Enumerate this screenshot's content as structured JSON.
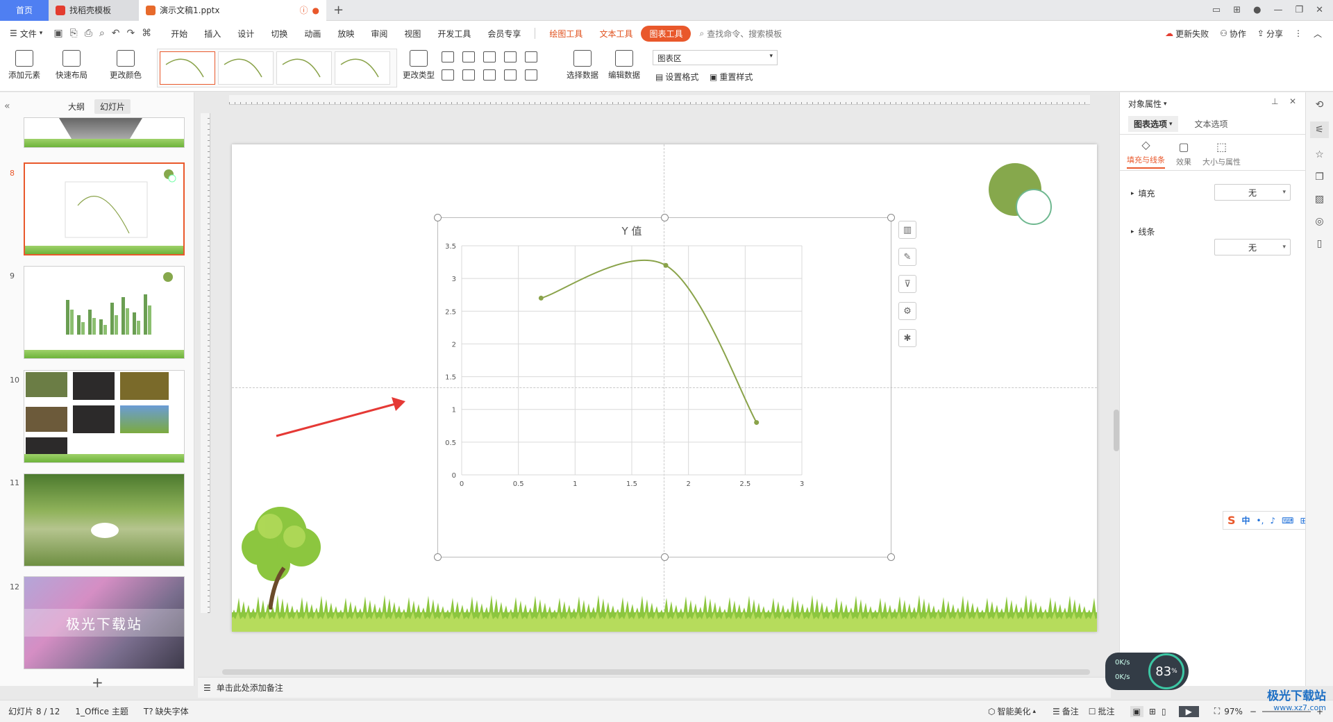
{
  "titlebar": {
    "tabs": [
      {
        "label": "首页"
      },
      {
        "label": "找稻壳模板"
      },
      {
        "label": "演示文稿1.pptx"
      }
    ],
    "new_tab": "+"
  },
  "menubar": {
    "file": "文件",
    "items": [
      "开始",
      "插入",
      "设计",
      "切换",
      "动画",
      "放映",
      "审阅",
      "视图",
      "开发工具",
      "会员专享"
    ],
    "tool_tabs": [
      "绘图工具",
      "文本工具",
      "图表工具"
    ],
    "search_placeholder": "查找命令、搜索模板",
    "right": {
      "update": "更新失败",
      "collab": "协作",
      "share": "分享"
    }
  },
  "ribbon": {
    "add_element": "添加元素",
    "quick_layout": "快速布局",
    "change_color": "更改颜色",
    "change_type": "更改类型",
    "select_data": "选择数据",
    "edit_data": "编辑数据",
    "chart_area_select": "图表区",
    "set_format": "设置格式",
    "reset_style": "重置样式"
  },
  "leftpanel": {
    "tab_outline": "大纲",
    "tab_slides": "幻灯片",
    "numbers": [
      "8",
      "9",
      "10",
      "11",
      "12"
    ],
    "slide12_text": "极光下载站",
    "add": "+"
  },
  "chart_data": {
    "type": "scatter",
    "title": "Y 值",
    "xlim": [
      0,
      3
    ],
    "ylim": [
      0,
      3.5
    ],
    "xticks": [
      "0",
      "0.5",
      "1",
      "1.5",
      "2",
      "2.5",
      "3"
    ],
    "yticks": [
      "0",
      "0.5",
      "1",
      "1.5",
      "2",
      "2.5",
      "3",
      "3.5"
    ],
    "points": [
      {
        "x": 0.7,
        "y": 2.7
      },
      {
        "x": 1.8,
        "y": 3.2
      },
      {
        "x": 2.6,
        "y": 0.8
      }
    ],
    "smooth": true,
    "grid": true,
    "color": "#8aa34a"
  },
  "rightpanel": {
    "title": "对象属性",
    "tab_chart": "图表选项",
    "tab_text": "文本选项",
    "sub_fill": "填充与线条",
    "sub_effect": "效果",
    "sub_size": "大小与属性",
    "fill_label": "填充",
    "fill_value": "无",
    "line_label": "线条",
    "line_value": "无"
  },
  "notes": {
    "placeholder": "单击此处添加备注"
  },
  "statusbar": {
    "slide_info": "幻灯片 8 / 12",
    "theme": "1_Office 主题",
    "missing_font": "缺失字体",
    "beautify": "智能美化",
    "notes_btn": "备注",
    "comment_btn": "批注",
    "zoom": "97%"
  },
  "netwidget": {
    "up": "0K/s",
    "down": "0K/s",
    "percent": "83"
  },
  "ime": {
    "text": "中"
  },
  "watermark": {
    "text": "极光下载站",
    "url": "www.xz7.com"
  },
  "colors": {
    "accent": "#e9582b",
    "home_tab": "#4f7ff2",
    "chart_line": "#8aa34a",
    "deco_circle": "#86a84c"
  }
}
